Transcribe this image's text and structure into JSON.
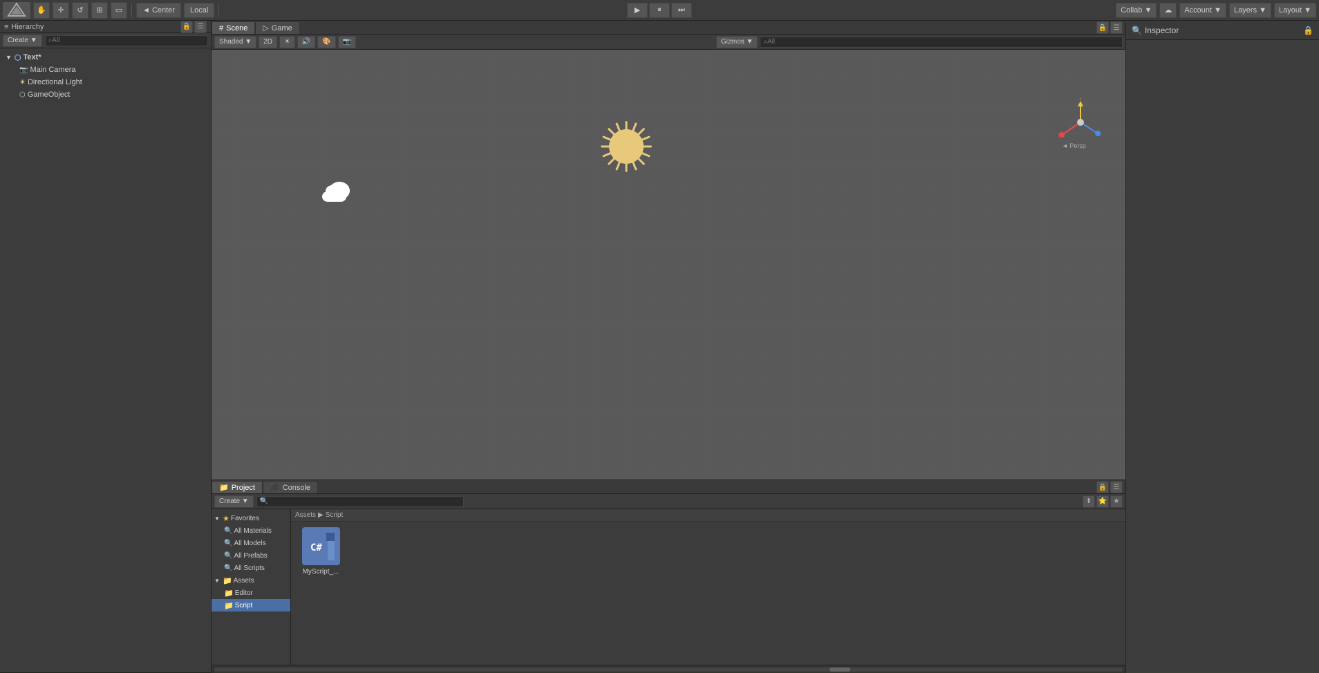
{
  "toolbar": {
    "transform_tools": [
      "◎",
      "✛",
      "⊕",
      "↔",
      "⟲"
    ],
    "center_label": "◄ Center",
    "local_label": "Local",
    "play_label": "▶",
    "pause_label": "⏸",
    "step_label": "⏭",
    "collab_label": "Collab ▼",
    "account_label": "Account ▼",
    "layers_label": "Layers ▼",
    "layout_label": "Layout ▼"
  },
  "hierarchy": {
    "title": "Hierarchy",
    "create_label": "Create ▼",
    "search_placeholder": "⌕All",
    "items": [
      {
        "label": "Text*",
        "type": "scene",
        "indent": 0,
        "expanded": true
      },
      {
        "label": "Main Camera",
        "type": "camera",
        "indent": 1
      },
      {
        "label": "Directional Light",
        "type": "light",
        "indent": 1
      },
      {
        "label": "GameObject",
        "type": "object",
        "indent": 1
      }
    ]
  },
  "scene": {
    "tab_label": "Scene",
    "game_tab_label": "Game",
    "shading_label": "Shaded ▼",
    "mode_label": "2D",
    "gizmos_label": "Gizmos ▼",
    "search_placeholder": "⌕All"
  },
  "inspector": {
    "title": "Inspector"
  },
  "project": {
    "tab_label": "Project",
    "console_tab_label": "Console",
    "create_label": "Create ▼",
    "breadcrumb": [
      "Assets",
      "Script"
    ],
    "favorites": {
      "label": "Favorites",
      "items": [
        "All Materials",
        "All Models",
        "All Prefabs",
        "All Scripts"
      ]
    },
    "assets": {
      "label": "Assets",
      "children": [
        {
          "label": "Editor"
        },
        {
          "label": "Script",
          "selected": true
        }
      ]
    },
    "files": [
      {
        "label": "MyScript_...",
        "type": "csharp"
      }
    ]
  }
}
